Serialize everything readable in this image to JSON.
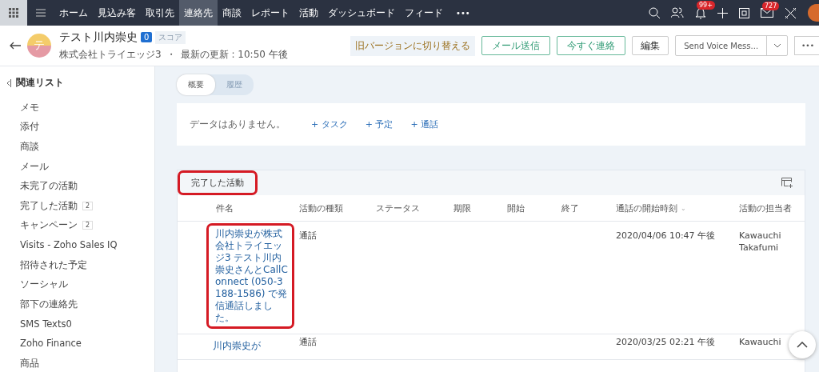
{
  "topbar": {
    "nav": [
      {
        "label": "ホーム",
        "selected": false
      },
      {
        "label": "見込み客",
        "selected": false
      },
      {
        "label": "取引先",
        "selected": false
      },
      {
        "label": "連絡先",
        "selected": true
      },
      {
        "label": "商談",
        "selected": false
      },
      {
        "label": "レポート",
        "selected": false
      },
      {
        "label": "活動",
        "selected": false
      },
      {
        "label": "ダッシュボード",
        "selected": false
      },
      {
        "label": "フィード",
        "selected": false
      }
    ],
    "more": "•••",
    "notifications_badge": "99+",
    "mail_badge": "727"
  },
  "record": {
    "avatar_letter": "テ",
    "name": "テスト川内崇史",
    "score": "0",
    "score_label": "スコア",
    "company": "株式会社トライエッジ3",
    "separator": "・",
    "updated": "最新の更新 : 10:50 午後",
    "switch_version": "旧バージョンに切り替える",
    "buttons": [
      {
        "label": "メール送信",
        "kind": "primary"
      },
      {
        "label": "今すぐ連絡",
        "kind": "primary"
      },
      {
        "label": "編集",
        "kind": "plain"
      }
    ],
    "dropdown": "Send Voice Mess...",
    "more": "•••"
  },
  "sidebar": {
    "title": "関連リスト",
    "items": [
      {
        "label": "メモ"
      },
      {
        "label": "添付"
      },
      {
        "label": "商談"
      },
      {
        "label": "メール"
      },
      {
        "label": "未完了の活動"
      },
      {
        "label": "完了した活動",
        "count": "2"
      },
      {
        "label": "キャンペーン",
        "count": "2"
      },
      {
        "label": "Visits - Zoho Sales IQ"
      },
      {
        "label": "招待された予定"
      },
      {
        "label": "ソーシャル"
      },
      {
        "label": "部下の連絡先"
      },
      {
        "label": "SMS Texts0"
      },
      {
        "label": "Zoho Finance"
      },
      {
        "label": "商品"
      }
    ]
  },
  "tabs": [
    {
      "label": "概要",
      "selected": true
    },
    {
      "label": "履歴",
      "selected": false
    }
  ],
  "open_activities": {
    "empty": "データはありません。",
    "actions": [
      "+ タスク",
      "+ 予定",
      "+ 通話"
    ]
  },
  "closed_activities": {
    "title": "完了した活動",
    "highlighted": true,
    "columns": [
      "件名",
      "活動の種類",
      "ステータス",
      "期限",
      "開始",
      "終了",
      "通話の開始時刻",
      "活動の担当者"
    ],
    "sort_mark": "⌄",
    "rows": [
      {
        "subject": "川内崇史が株式会社トライエッジ3 テスト川内崇史さんとCallConnect (050-3188-1586) で発信通話しました。",
        "highlighted": true,
        "type": "通話",
        "call_start": "2020/04/06 10:47 午後",
        "owner": "Kawauchi Takafumi"
      },
      {
        "subject": "川内崇史が",
        "highlighted": false,
        "type": "通話",
        "call_start": "2020/03/25 02:21 午後",
        "owner": "Kawauchi"
      }
    ]
  }
}
